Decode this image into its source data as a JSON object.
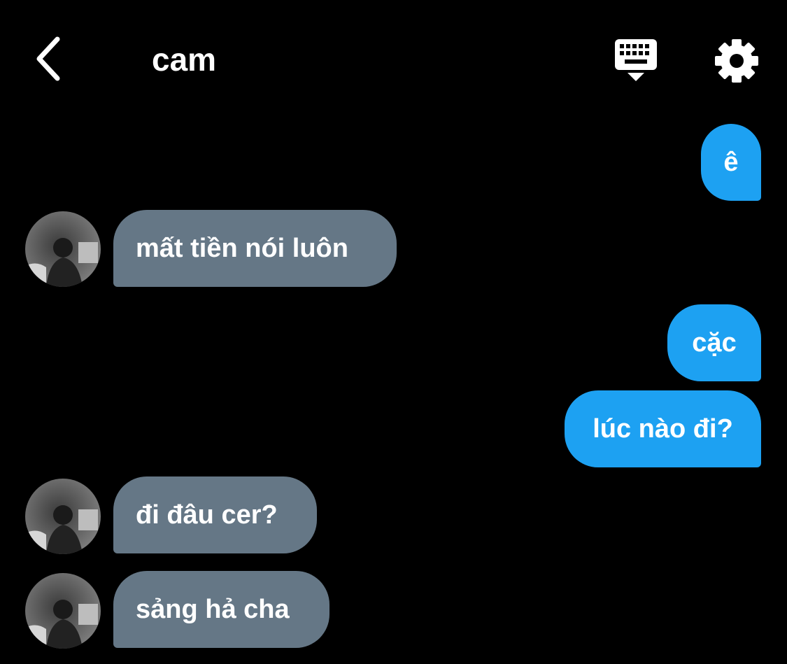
{
  "header": {
    "title": "cam",
    "back_icon": "chevron-left-icon",
    "keyboard_icon": "keyboard-hide-icon",
    "settings_icon": "gear-icon"
  },
  "messages": [
    {
      "dir": "out",
      "text": "ê"
    },
    {
      "dir": "in",
      "text": "mất tiền nói luôn"
    },
    {
      "dir": "out",
      "text": "cặc"
    },
    {
      "dir": "out",
      "text": "lúc nào đi?"
    },
    {
      "dir": "in",
      "text": "đi đâu cer?"
    },
    {
      "dir": "in",
      "text": "sảng hả cha"
    }
  ],
  "colors": {
    "background": "#000000",
    "outgoing_bubble": "#1da1f2",
    "incoming_bubble": "#657786",
    "text": "#ffffff"
  }
}
